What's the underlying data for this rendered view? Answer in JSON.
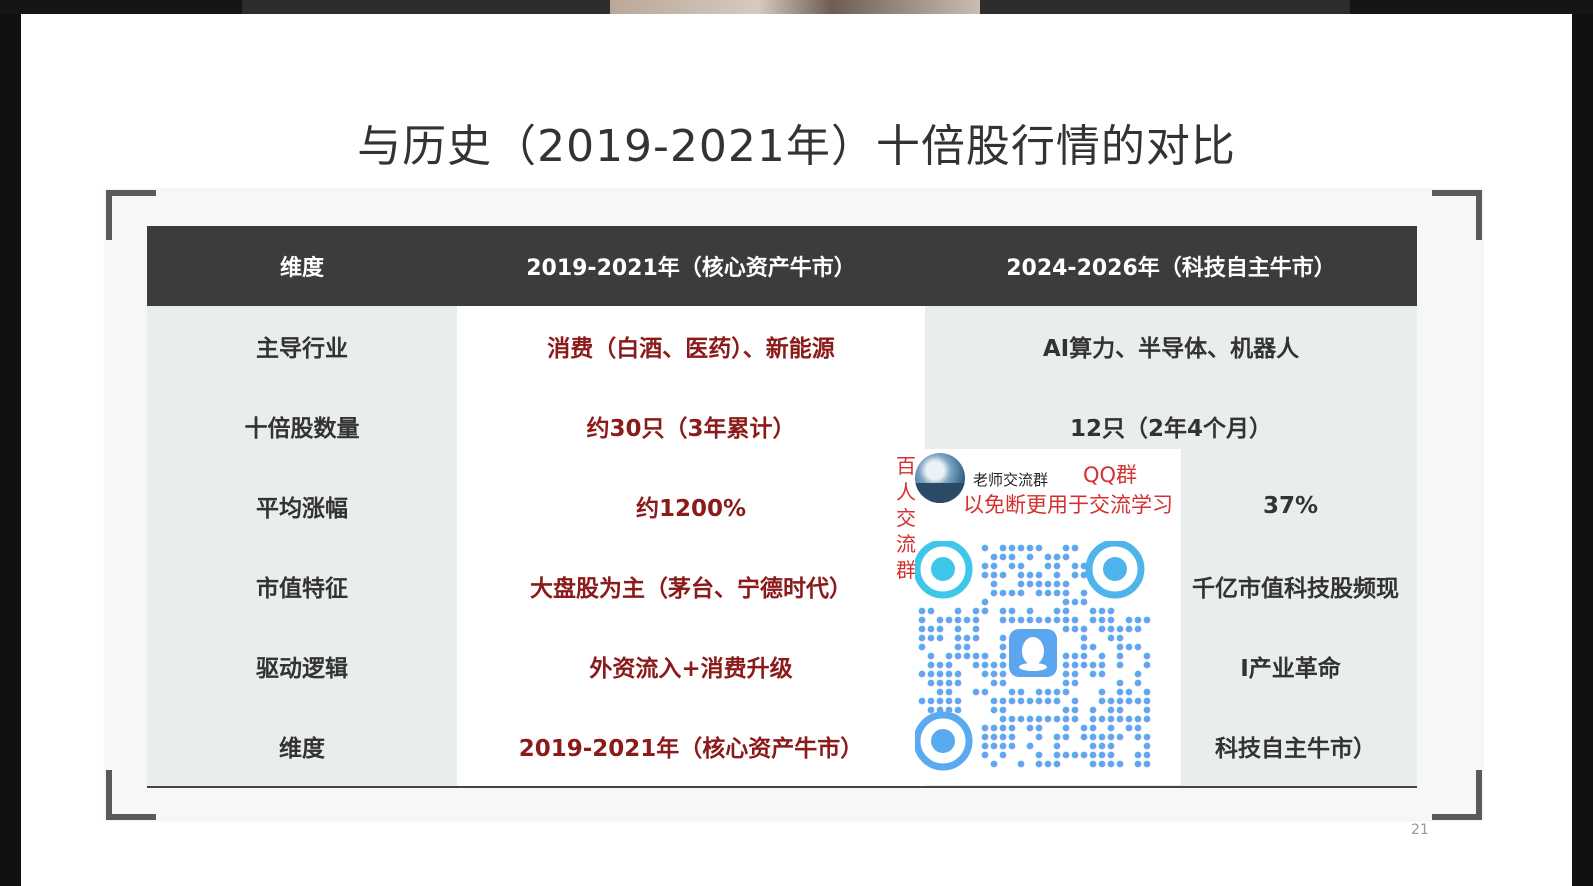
{
  "slide": {
    "title": "与历史（2019-2021年）十倍股行情的对比",
    "page_number": "21"
  },
  "table": {
    "headers": [
      "维度",
      "2019-2021年（核心资产牛市）",
      "2024-2026年（科技自主牛市）"
    ],
    "rows": [
      [
        "主导行业",
        "消费（白酒、医药）、新能源",
        "AI算力、半导体、机器人"
      ],
      [
        "十倍股数量",
        "约30只（3年累计）",
        "12只（2年4个月）"
      ],
      [
        "平均涨幅",
        "约1200%",
        "37%"
      ],
      [
        "市值特征",
        "大盘股为主（茅台、宁德时代）",
        "千亿市值科技股频现"
      ],
      [
        "驱动逻辑",
        "外资流入+消费升级",
        "I产业革命"
      ],
      [
        "维度",
        "2019-2021年（核心资产牛市）",
        "科技自主牛市）"
      ]
    ]
  },
  "qr_overlay": {
    "vertical_text": [
      "百",
      "人",
      "交",
      "流",
      "群"
    ],
    "group_name": "老师交流群",
    "qq_label": "QQ群",
    "subtitle": "以免断更用于交流学习",
    "icon": "qq-penguin-icon",
    "accent_color": "#d43030"
  }
}
